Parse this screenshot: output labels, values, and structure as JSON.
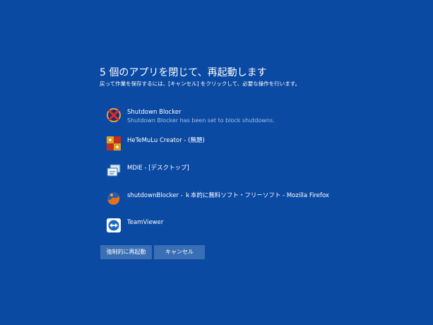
{
  "dialog": {
    "title": "5 個のアプリを閉じて、再起動します",
    "subtitle": "戻って作業を保存するには、[キャンセル] をクリックして、必要な操作を行います。"
  },
  "apps": [
    {
      "name": "Shutdown Blocker",
      "status": "Shutdown Blocker has been set to block shutdowns.",
      "icon": "shutdown-blocker-icon"
    },
    {
      "name": "HeTeMuLu Creator - (無題)",
      "status": "",
      "icon": "hetemulu-creator-icon"
    },
    {
      "name": "MDIE - [デスクトップ]",
      "status": "",
      "icon": "mdie-icon"
    },
    {
      "name": "shutdownBlocker - ｋ本的に無料ソフト・フリーソフト - Mozilla Firefox",
      "status": "",
      "icon": "firefox-icon"
    },
    {
      "name": "TeamViewer",
      "status": "",
      "icon": "teamviewer-icon"
    }
  ],
  "buttons": {
    "force_restart": "強制的に再起動",
    "cancel": "キャンセル"
  },
  "colors": {
    "background": "#0b4aa3",
    "button": "#3a6fb5",
    "status_text": "#9fc0e6"
  }
}
